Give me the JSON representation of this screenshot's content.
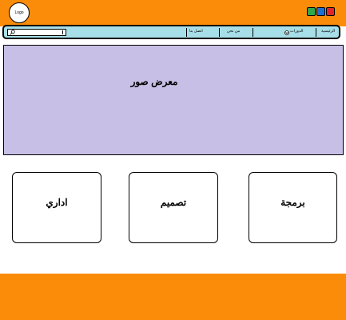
{
  "header": {
    "logo_text": "Logo",
    "window_buttons": [
      {
        "name": "green",
        "color": "#2fa84f"
      },
      {
        "name": "blue",
        "color": "#1f6fd1"
      },
      {
        "name": "red",
        "color": "#e0262b"
      }
    ]
  },
  "nav": {
    "items": [
      {
        "label": "الرئيسية"
      },
      {
        "label": "الدورات",
        "icon": "chevron-down-icon"
      },
      {
        "label": "من نحن"
      },
      {
        "label": "اتصل بنا"
      }
    ],
    "search": {
      "icon": "search-icon",
      "value": ""
    }
  },
  "gallery": {
    "title": "معرض صور"
  },
  "cards": [
    {
      "label": "اداري"
    },
    {
      "label": "تصميم"
    },
    {
      "label": "برمجة"
    }
  ],
  "colors": {
    "header_bg": "#fb8c0a",
    "nav_bg": "#a7dfe8",
    "gallery_bg": "#c7bfe6",
    "footer_bg": "#fb8c0a"
  }
}
